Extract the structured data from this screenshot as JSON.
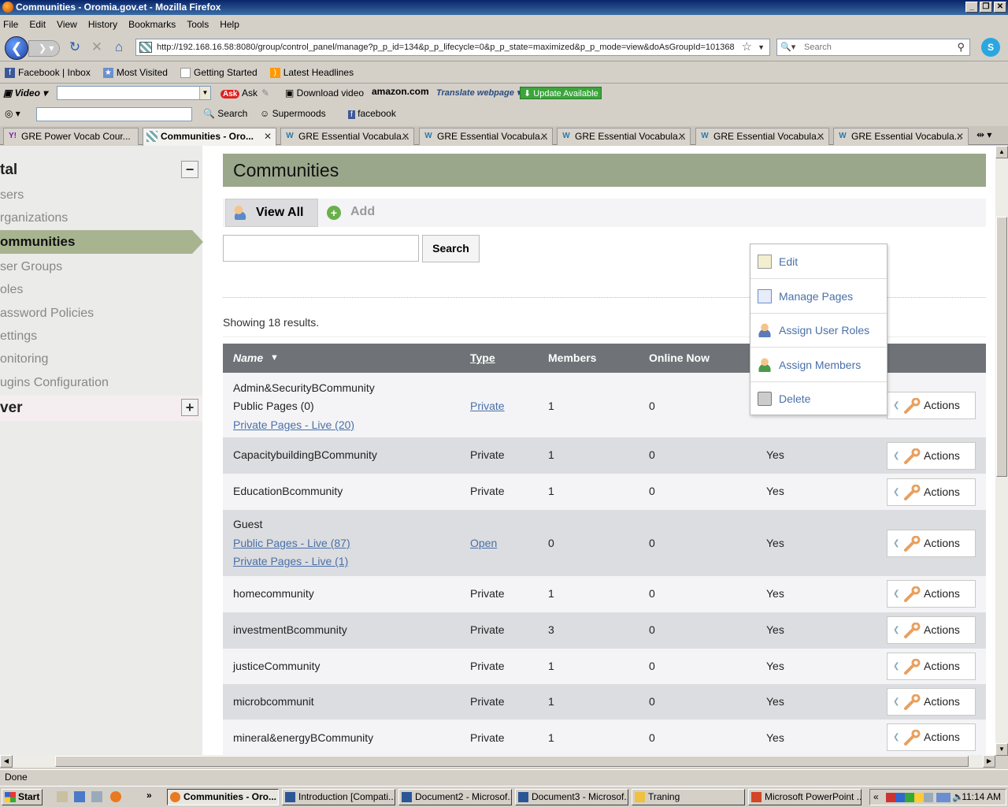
{
  "window": {
    "title": "Communities - Oromia.gov.et - Mozilla Firefox"
  },
  "menu": [
    "File",
    "Edit",
    "View",
    "History",
    "Bookmarks",
    "Tools",
    "Help"
  ],
  "address": {
    "url": "http://192.168.16.58:8080/group/control_panel/manage?p_p_id=134&p_p_lifecycle=0&p_p_state=maximized&p_p_mode=view&doAsGroupId=101368",
    "search_placeholder": "Search"
  },
  "bookmarks": [
    "Facebook | Inbox",
    "Most Visited",
    "Getting Started",
    "Latest Headlines"
  ],
  "toolbar1": {
    "video": "Video",
    "ask": "Ask",
    "download": "Download video",
    "amazon": "amazon.com",
    "translate": "Translate webpage",
    "update": "Update Available"
  },
  "toolbar2": {
    "search": "Search",
    "supermoods": "Supermoods",
    "facebook": "facebook"
  },
  "tabs": [
    {
      "label": "GRE Power Vocab Cour..."
    },
    {
      "label": "Communities - Oro..."
    },
    {
      "label": "GRE Essential Vocabula..."
    },
    {
      "label": "GRE Essential Vocabula..."
    },
    {
      "label": "GRE Essential Vocabula..."
    },
    {
      "label": "GRE Essential Vocabula..."
    },
    {
      "label": "GRE Essential Vocabula..."
    }
  ],
  "sidebar": {
    "section1": "tal",
    "items": [
      "sers",
      "rganizations",
      "ommunities",
      "ser Groups",
      "oles",
      "assword Policies",
      "ettings",
      "onitoring",
      "ugins Configuration"
    ],
    "section2": "ver"
  },
  "portlet": {
    "title": "Communities",
    "view_all": "View All",
    "add": "Add",
    "search_btn": "Search",
    "showing": "Showing 18 results."
  },
  "table": {
    "headers": {
      "name": "Name",
      "type": "Type",
      "members": "Members",
      "online": "Online Now"
    },
    "action_label": "Actions",
    "rows": [
      {
        "name": "Admin&SecurityBCommunity",
        "sub1": "Public Pages (0)",
        "sub2": "Private Pages - Live (20)",
        "type": "Private",
        "members": "1",
        "online": "0",
        "active": ""
      },
      {
        "name": "CapacitybuildingBCommunity",
        "type": "Private",
        "members": "1",
        "online": "0",
        "active": "Yes"
      },
      {
        "name": "EducationBcommunity",
        "type": "Private",
        "members": "1",
        "online": "0",
        "active": "Yes"
      },
      {
        "name": "Guest",
        "sub1": "Public Pages - Live (87)",
        "sub2": "Private Pages - Live (1)",
        "type": "Open",
        "members": "0",
        "online": "0",
        "active": "Yes"
      },
      {
        "name": "homecommunity",
        "type": "Private",
        "members": "1",
        "online": "0",
        "active": "Yes"
      },
      {
        "name": "investmentBcommunity",
        "type": "Private",
        "members": "3",
        "online": "0",
        "active": "Yes"
      },
      {
        "name": "justiceCommunity",
        "type": "Private",
        "members": "1",
        "online": "0",
        "active": "Yes"
      },
      {
        "name": "microbcommunit",
        "type": "Private",
        "members": "1",
        "online": "0",
        "active": "Yes"
      },
      {
        "name": "mineral&energyBCommunity",
        "type": "Private",
        "members": "1",
        "online": "0",
        "active": "Yes"
      }
    ]
  },
  "action_menu": [
    "Edit",
    "Manage Pages",
    "Assign User Roles",
    "Assign Members",
    "Delete"
  ],
  "status": "Done",
  "taskbar": {
    "start": "Start",
    "tasks": [
      "Communities - Oro...",
      "Introduction [Compati...",
      "Document2 - Microsof...",
      "Document3 - Microsof...",
      "Traning",
      "Microsoft PowerPoint ..."
    ],
    "clock": "11:14 AM"
  }
}
